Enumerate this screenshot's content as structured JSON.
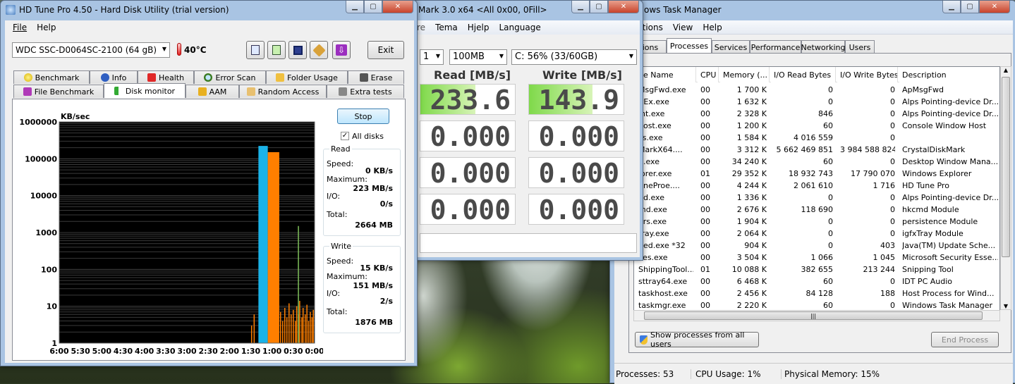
{
  "hdtune": {
    "title": "HD Tune Pro 4.50 - Hard Disk Utility (trial version)",
    "menu": [
      "File",
      "Help"
    ],
    "drive": "WDC SSC-D0064SC-2100    (64 gB)",
    "temp": "40°C",
    "exit": "Exit",
    "tabs_row1": [
      "Benchmark",
      "Info",
      "Health",
      "Error Scan",
      "Folder Usage",
      "Erase"
    ],
    "tabs_row2": [
      "File Benchmark",
      "Disk monitor",
      "AAM",
      "Random Access",
      "Extra tests"
    ],
    "chart": {
      "y_unit": "KB/sec",
      "y_ticks": [
        "1000000",
        "100000",
        "10000",
        "1000",
        "100",
        "10",
        "1"
      ],
      "x_ticks": [
        "6:00",
        "5:30",
        "5:00",
        "4:30",
        "4:00",
        "3:30",
        "3:00",
        "2:30",
        "2:00",
        "1:30",
        "1:00",
        "0:30",
        "0:00"
      ]
    },
    "stop": "Stop",
    "all_disks": "All disks",
    "read": {
      "title": "Read",
      "speed_label": "Speed:",
      "speed": "0 KB/s",
      "max_label": "Maximum:",
      "max": "223 MB/s",
      "io_label": "I/O:",
      "io": "0/s",
      "total_label": "Total:",
      "total": "2664 MB"
    },
    "write": {
      "title": "Write",
      "speed_label": "Speed:",
      "speed": "15 KB/s",
      "max_label": "Maximum:",
      "max": "151 MB/s",
      "io_label": "I/O:",
      "io": "2/s",
      "total_label": "Total:",
      "total": "1876 MB"
    }
  },
  "cdm": {
    "title": "Mark 3.0 x64 <All 0x00, 0Fill>",
    "menu": [
      "re",
      "Tema",
      "Hjelp",
      "Language"
    ],
    "count": "1",
    "size": "100MB",
    "drive": "C: 56% (33/60GB)",
    "read_header": "Read [MB/s]",
    "write_header": "Write [MB/s]",
    "rows": [
      {
        "read": "233.6",
        "write": "143.9",
        "read_fill": 0.58,
        "write_fill": 0.67
      },
      {
        "read": "0.000",
        "write": "0.000",
        "read_fill": 0,
        "write_fill": 0
      },
      {
        "read": "0.000",
        "write": "0.000",
        "read_fill": 0,
        "write_fill": 0
      },
      {
        "read": "0.000",
        "write": "0.000",
        "read_fill": 0,
        "write_fill": 0
      }
    ]
  },
  "taskmgr": {
    "title": "ows Task Manager",
    "menu": [
      "ptions",
      "View",
      "Help"
    ],
    "tabs": [
      "ions",
      "Processes",
      "Services",
      "Performance",
      "Networking",
      "Users"
    ],
    "columns": [
      "ge Name",
      "CPU",
      "Memory (...",
      "I/O Read Bytes",
      "I/O Write Bytes",
      "Description"
    ],
    "rows": [
      [
        "MsgFwd.exe",
        "00",
        "1 700 K",
        "0",
        "0",
        "ApMsgFwd"
      ],
      [
        "ltEx.exe",
        "00",
        "1 632 K",
        "0",
        "0",
        "Alps Pointing-device Dr..."
      ],
      [
        "int.exe",
        "00",
        "2 328 K",
        "846",
        "0",
        "Alps Pointing-device Dr..."
      ],
      [
        "host.exe",
        "00",
        "1 200 K",
        "60",
        "0",
        "Console Window Host"
      ],
      [
        "ss.exe",
        "00",
        "1 584 K",
        "4 016 559",
        "0",
        ""
      ],
      [
        "MarkX64....",
        "00",
        "3 312 K",
        "5 662 469 851",
        "3 984 588 824",
        "CrystalDiskMark"
      ],
      [
        "n.exe",
        "00",
        "34 240 K",
        "60",
        "0",
        "Desktop Window Mana..."
      ],
      [
        "lorer.exe",
        "01",
        "29 352 K",
        "18 932 743",
        "17 790 070",
        "Windows Explorer"
      ],
      [
        "uneProe....",
        "00",
        "4 244 K",
        "2 061 610",
        "1 716",
        "HD Tune Pro"
      ],
      [
        "nd.exe",
        "00",
        "1 336 K",
        "0",
        "0",
        "Alps Pointing-device Dr..."
      ],
      [
        "md.exe",
        "00",
        "2 676 K",
        "118 690",
        "0",
        "hkcmd Module"
      ],
      [
        "ers.exe",
        "00",
        "1 904 K",
        "0",
        "0",
        "persistence Module"
      ],
      [
        "tray.exe",
        "00",
        "2 064 K",
        "0",
        "0",
        "igfxTray Module"
      ],
      [
        "hed.exe *32",
        "00",
        "904 K",
        "0",
        "403",
        "Java(TM) Update Sche..."
      ],
      [
        "ces.exe",
        "00",
        "3 504 K",
        "1 066",
        "1 045",
        "Microsoft Security Esse..."
      ],
      [
        "ShippingTool....",
        "01",
        "10 088 K",
        "382 655",
        "213 244",
        "Snipping Tool"
      ],
      [
        "sttray64.exe",
        "00",
        "6 468 K",
        "60",
        "0",
        "IDT PC Audio"
      ],
      [
        "taskhost.exe",
        "00",
        "2 456 K",
        "84 128",
        "188",
        "Host Process for Wind..."
      ],
      [
        "taskmgr.exe",
        "00",
        "2 220 K",
        "60",
        "0",
        "Windows Task Manager"
      ]
    ],
    "show_all": "Show processes from all users",
    "end_process": "End Process",
    "status": {
      "processes": "Processes: 53",
      "cpu": "CPU Usage: 1%",
      "memory": "Physical Memory: 15%"
    }
  },
  "colors": {
    "read": "#1ab3e8",
    "write": "#ff7f00",
    "chart_bg": "#000000"
  }
}
